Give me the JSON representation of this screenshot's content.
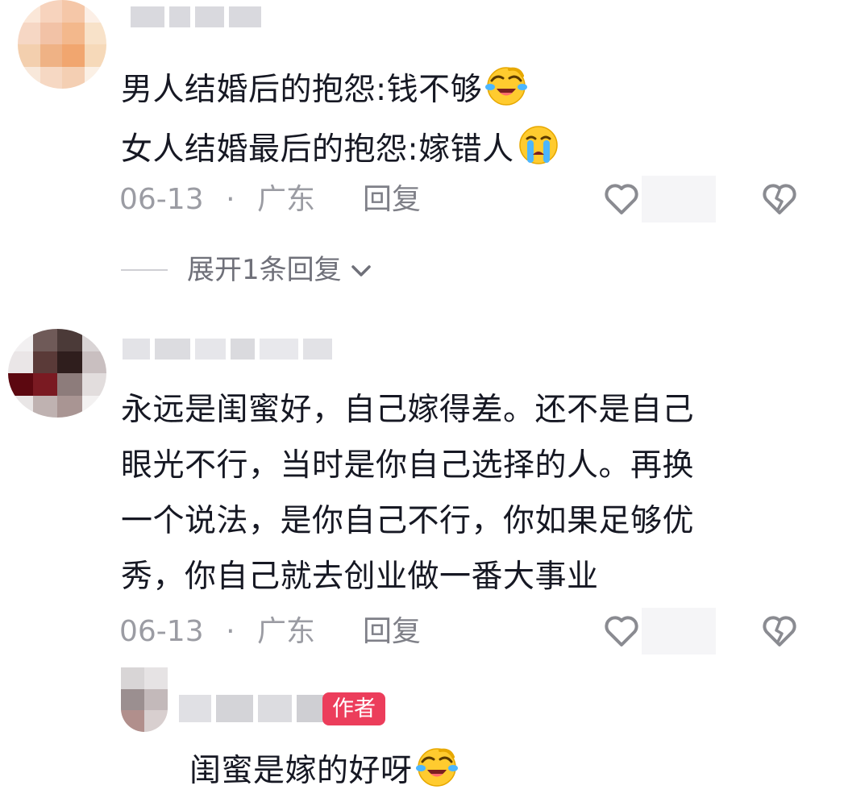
{
  "comments": [
    {
      "lines": [
        "男人结婚后的抱怨:钱不够",
        "女人结婚最后的抱怨:嫁错人"
      ],
      "emojis": [
        "laughing-crying-emoji",
        "crying-emoji"
      ],
      "date": "06-13",
      "separator": "·",
      "location": "广东",
      "reply_label": "回复",
      "expand_label": "展开1条回复"
    },
    {
      "lines": [
        "永远是闺蜜好，自己嫁得差。还不是自己",
        "眼光不行，当时是你自己选择的人。再换",
        "一个说法，是你自己不行，你如果足够优",
        "秀，你自己就去创业做一番大事业"
      ],
      "date": "06-13",
      "separator": "·",
      "location": "广东",
      "reply_label": "回复"
    }
  ],
  "reply": {
    "author_badge": "作者",
    "text": "闺蜜是嫁的好呀",
    "emoji": "laughing-crying-emoji"
  },
  "colors": {
    "text": "#161823",
    "meta": "#9b9ca3",
    "badge": "#ec3d5b"
  }
}
